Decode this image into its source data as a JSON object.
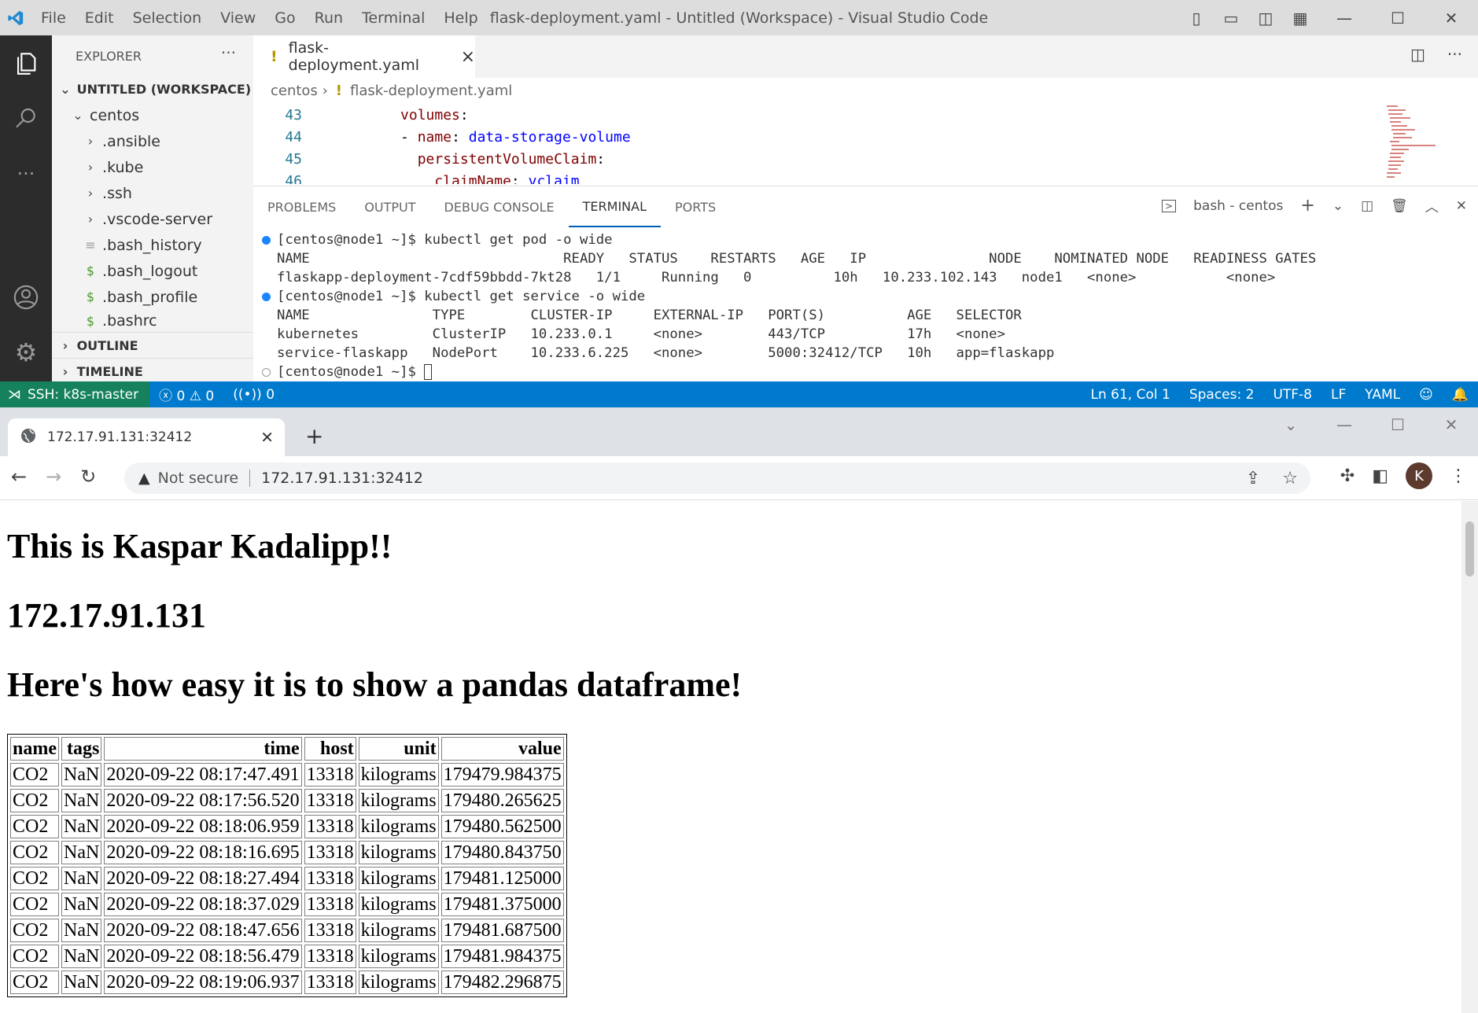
{
  "vscode": {
    "menu": [
      "File",
      "Edit",
      "Selection",
      "View",
      "Go",
      "Run",
      "Terminal",
      "Help"
    ],
    "window_title": "flask-deployment.yaml - Untitled (Workspace) - Visual Studio Code",
    "explorer": {
      "header": "EXPLORER",
      "workspace": "UNTITLED (WORKSPACE)",
      "root_folder": "centos",
      "folders": [
        ".ansible",
        ".kube",
        ".ssh",
        ".vscode-server"
      ],
      "files": [
        {
          "name": ".bash_history",
          "icon": "lines-icon"
        },
        {
          "name": ".bash_logout",
          "icon": "dollar-icon"
        },
        {
          "name": ".bash_profile",
          "icon": "dollar-icon"
        },
        {
          "name": ".bashrc",
          "icon": "dollar-icon"
        }
      ],
      "outline": "OUTLINE",
      "timeline": "TIMELINE"
    },
    "tab": {
      "bang": "!",
      "label": "flask-deployment.yaml",
      "close": "×"
    },
    "breadcrumb": {
      "folder": "centos",
      "sep": "›",
      "bang": "!",
      "file": "flask-deployment.yaml"
    },
    "code": [
      {
        "ln": "43",
        "indent": "      ",
        "key": "volumes",
        "after": ":",
        "val": ""
      },
      {
        "ln": "44",
        "indent": "      - ",
        "key": "name",
        "after": ": ",
        "val": "data-storage-volume"
      },
      {
        "ln": "45",
        "indent": "        ",
        "key": "persistentVolumeClaim",
        "after": ":",
        "val": ""
      },
      {
        "ln": "46",
        "indent": "          ",
        "key": "claimName",
        "after": ": ",
        "val": "vclaim"
      }
    ],
    "panel_tabs": [
      "PROBLEMS",
      "OUTPUT",
      "DEBUG CONSOLE",
      "TERMINAL",
      "PORTS"
    ],
    "active_panel_tab": "TERMINAL",
    "terminal_name": "bash - centos",
    "terminal_lines": [
      {
        "dot": "blue",
        "text": "[centos@node1 ~]$ kubectl get pod -o wide"
      },
      {
        "dot": "",
        "text": "NAME                               READY   STATUS    RESTARTS   AGE   IP               NODE    NOMINATED NODE   READINESS GATES"
      },
      {
        "dot": "",
        "text": "flaskapp-deployment-7cdf59bbdd-7kt28   1/1     Running   0          10h   10.233.102.143   node1   <none>           <none>"
      },
      {
        "dot": "blue",
        "text": "[centos@node1 ~]$ kubectl get service -o wide"
      },
      {
        "dot": "",
        "text": "NAME               TYPE        CLUSTER-IP     EXTERNAL-IP   PORT(S)          AGE   SELECTOR"
      },
      {
        "dot": "",
        "text": "kubernetes         ClusterIP   10.233.0.1     <none>        443/TCP          17h   <none>"
      },
      {
        "dot": "",
        "text": "service-flaskapp   NodePort    10.233.6.225   <none>        5000:32412/TCP   10h   app=flaskapp"
      },
      {
        "dot": "empty",
        "text": "[centos@node1 ~]$ "
      }
    ],
    "status": {
      "remote": "SSH: k8s-master",
      "errors": "0",
      "warnings": "0",
      "ports": "0",
      "position": "Ln 61, Col 1",
      "spaces": "Spaces: 2",
      "encoding": "UTF-8",
      "eol": "LF",
      "language": "YAML"
    }
  },
  "browser": {
    "tab_title": "172.17.91.131:32412",
    "security": "Not secure",
    "url": "172.17.91.131:32412",
    "avatar_letter": "K",
    "page": {
      "h1": "This is Kaspar Kadalipp!!",
      "h2": "172.17.91.131",
      "h3": "Here's how easy it is to show a pandas dataframe!",
      "columns": [
        "name",
        "tags",
        "time",
        "host",
        "unit",
        "value"
      ],
      "rows": [
        [
          "CO2",
          "NaN",
          "2020-09-22 08:17:47.491",
          "13318",
          "kilograms",
          "179479.984375"
        ],
        [
          "CO2",
          "NaN",
          "2020-09-22 08:17:56.520",
          "13318",
          "kilograms",
          "179480.265625"
        ],
        [
          "CO2",
          "NaN",
          "2020-09-22 08:18:06.959",
          "13318",
          "kilograms",
          "179480.562500"
        ],
        [
          "CO2",
          "NaN",
          "2020-09-22 08:18:16.695",
          "13318",
          "kilograms",
          "179480.843750"
        ],
        [
          "CO2",
          "NaN",
          "2020-09-22 08:18:27.494",
          "13318",
          "kilograms",
          "179481.125000"
        ],
        [
          "CO2",
          "NaN",
          "2020-09-22 08:18:37.029",
          "13318",
          "kilograms",
          "179481.375000"
        ],
        [
          "CO2",
          "NaN",
          "2020-09-22 08:18:47.656",
          "13318",
          "kilograms",
          "179481.687500"
        ],
        [
          "CO2",
          "NaN",
          "2020-09-22 08:18:56.479",
          "13318",
          "kilograms",
          "179481.984375"
        ],
        [
          "CO2",
          "NaN",
          "2020-09-22 08:19:06.937",
          "13318",
          "kilograms",
          "179482.296875"
        ]
      ]
    }
  },
  "colors": {
    "statusbar": "#007acc",
    "remote": "#16825d",
    "yaml_key": "#800000",
    "yaml_value": "#0000ff",
    "line_number": "#237893"
  }
}
